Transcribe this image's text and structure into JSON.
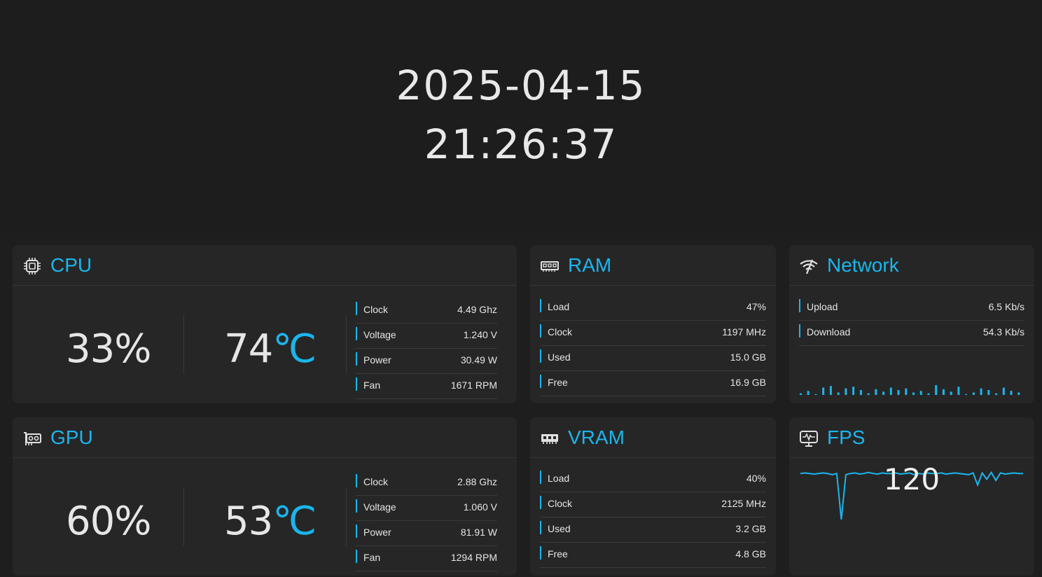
{
  "header": {
    "date": "2025-04-15",
    "time": "21:26:37"
  },
  "accent": "#1ab6ee",
  "cpu": {
    "title": "CPU",
    "icon": "cpu-chip-icon",
    "load": "33%",
    "temp": "74",
    "temp_unit": "℃",
    "rows": [
      {
        "label": "Clock",
        "value": "4.49 Ghz"
      },
      {
        "label": "Voltage",
        "value": "1.240 V"
      },
      {
        "label": "Power",
        "value": "30.49 W"
      },
      {
        "label": "Fan",
        "value": "1671 RPM"
      }
    ]
  },
  "gpu": {
    "title": "GPU",
    "icon": "graphics-card-icon",
    "load": "60%",
    "temp": "53",
    "temp_unit": "℃",
    "rows": [
      {
        "label": "Clock",
        "value": "2.88 Ghz"
      },
      {
        "label": "Voltage",
        "value": "1.060 V"
      },
      {
        "label": "Power",
        "value": "81.91 W"
      },
      {
        "label": "Fan",
        "value": "1294 RPM"
      }
    ]
  },
  "ram": {
    "title": "RAM",
    "icon": "memory-stick-icon",
    "rows": [
      {
        "label": "Load",
        "value": "47%"
      },
      {
        "label": "Clock",
        "value": "1197 MHz"
      },
      {
        "label": "Used",
        "value": "15.0 GB"
      },
      {
        "label": "Free",
        "value": "16.9 GB"
      }
    ]
  },
  "vram": {
    "title": "VRAM",
    "icon": "vram-icon",
    "rows": [
      {
        "label": "Load",
        "value": "40%"
      },
      {
        "label": "Clock",
        "value": "2125 MHz"
      },
      {
        "label": "Used",
        "value": "3.2 GB"
      },
      {
        "label": "Free",
        "value": "4.8 GB"
      }
    ]
  },
  "network": {
    "title": "Network",
    "icon": "wifi-signal-icon",
    "rows": [
      {
        "label": "Upload",
        "value": "6.5 Kb/s"
      },
      {
        "label": "Download",
        "value": "54.3 Kb/s"
      }
    ],
    "activity_bars": [
      2,
      5,
      1,
      9,
      11,
      3,
      8,
      10,
      6,
      2,
      7,
      4,
      9,
      6,
      8,
      3,
      5,
      2,
      12,
      7,
      4,
      10,
      1,
      3,
      8,
      6,
      2,
      9,
      5,
      3
    ]
  },
  "fps": {
    "title": "FPS",
    "icon": "monitor-pulse-icon",
    "value": "120",
    "history": [
      120,
      121,
      120,
      119,
      120,
      121,
      120,
      118,
      120,
      40,
      118,
      120,
      121,
      119,
      120,
      122,
      120,
      119,
      121,
      120,
      120,
      121,
      119,
      120,
      121,
      118,
      120,
      119,
      121,
      120,
      120,
      121,
      119,
      120,
      121,
      120,
      119,
      118,
      121,
      100,
      121,
      110,
      122,
      108,
      121,
      119,
      120,
      121,
      120,
      120
    ]
  }
}
